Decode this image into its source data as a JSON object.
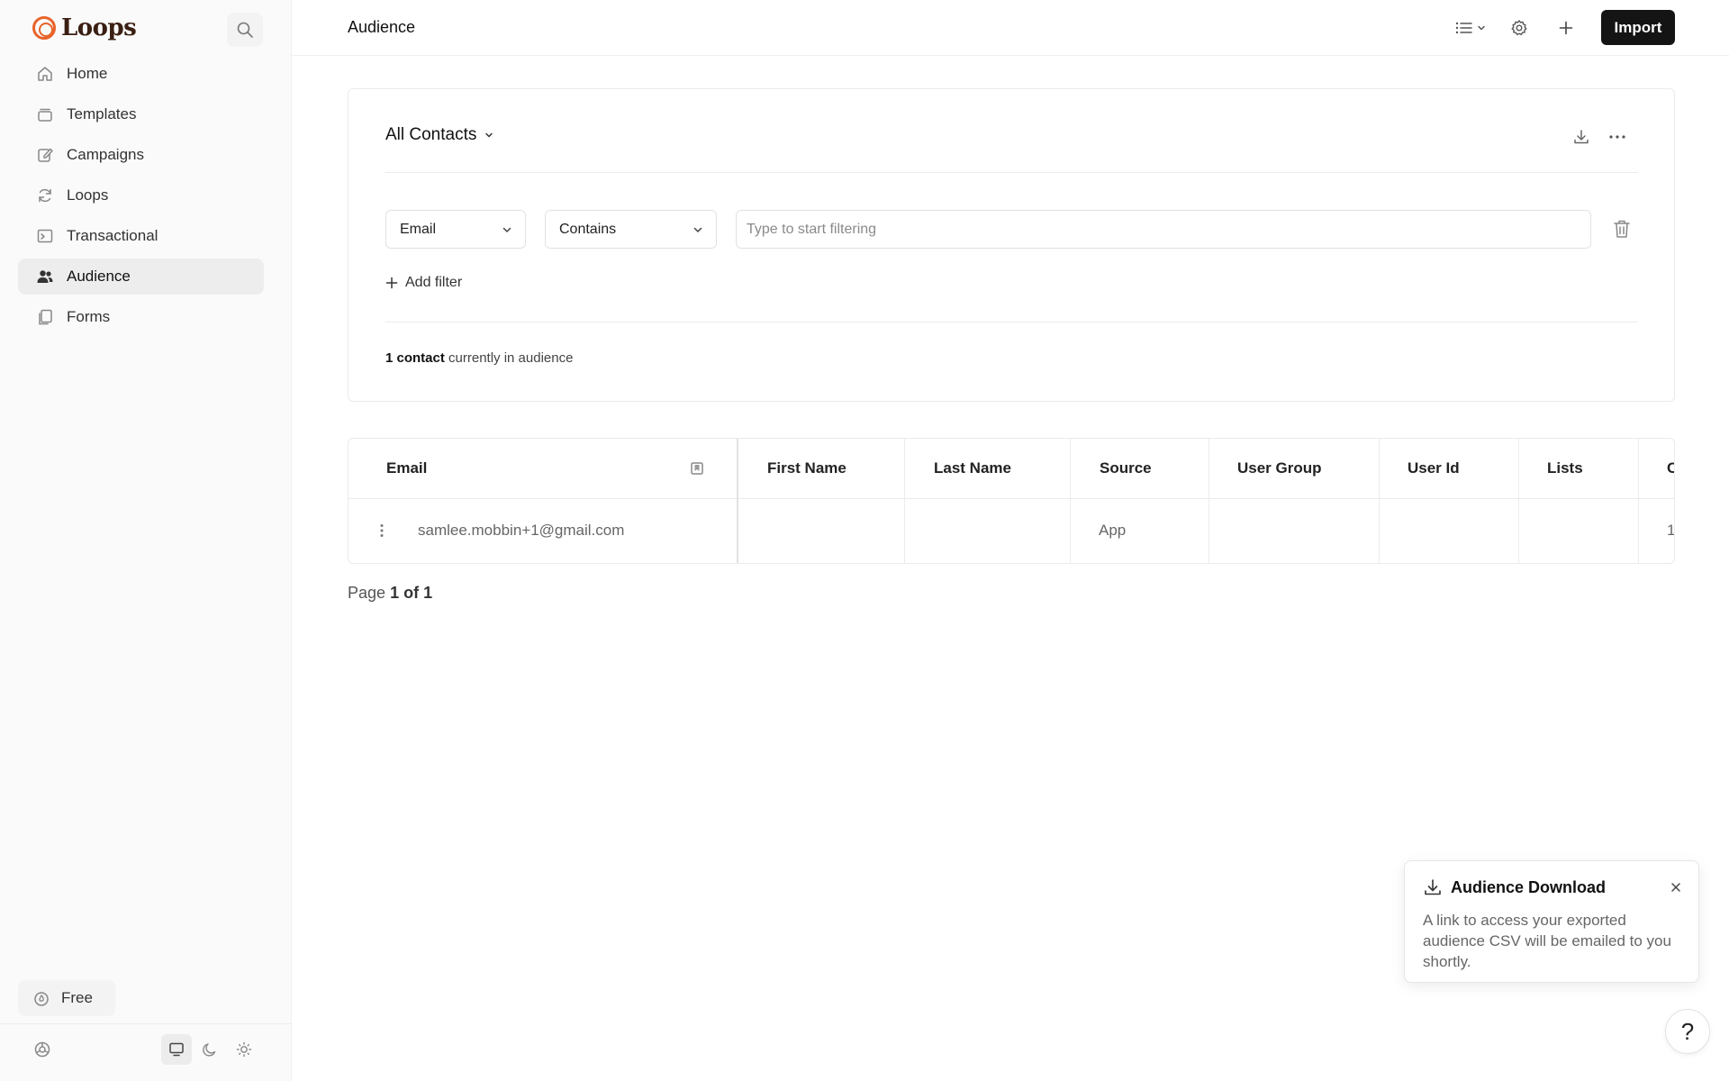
{
  "app": {
    "name": "Loops",
    "brand_color": "#e8632b"
  },
  "sidebar": {
    "items": [
      {
        "label": "Home",
        "icon": "home-icon"
      },
      {
        "label": "Templates",
        "icon": "templates-icon"
      },
      {
        "label": "Campaigns",
        "icon": "pencil-square-icon"
      },
      {
        "label": "Loops",
        "icon": "refresh-icon"
      },
      {
        "label": "Transactional",
        "icon": "terminal-icon"
      },
      {
        "label": "Audience",
        "icon": "users-icon",
        "active": true
      },
      {
        "label": "Forms",
        "icon": "documents-icon"
      }
    ],
    "plan_label": "Free"
  },
  "header": {
    "title": "Audience",
    "import_label": "Import"
  },
  "segment": {
    "title": "All Contacts"
  },
  "filter": {
    "field": "Email",
    "operator": "Contains",
    "value": "",
    "placeholder": "Type to start filtering",
    "add_label": "Add filter"
  },
  "summary": {
    "count": "1 contact",
    "suffix": "currently in audience"
  },
  "table": {
    "columns": [
      "Email",
      "First Name",
      "Last Name",
      "Source",
      "User Group",
      "User Id",
      "Lists",
      "C"
    ],
    "rows": [
      {
        "email": "samlee.mobbin+1@gmail.com",
        "first_name": "",
        "last_name": "",
        "source": "App",
        "user_group": "",
        "user_id": "",
        "lists": "",
        "extra": "1"
      }
    ]
  },
  "pagination": {
    "prefix": "Page",
    "value": "1 of 1"
  },
  "toast": {
    "title": "Audience Download",
    "body": "A link to access your exported audience CSV will be emailed to you shortly."
  },
  "help": {
    "label": "?"
  }
}
